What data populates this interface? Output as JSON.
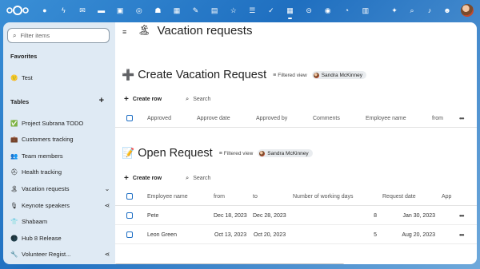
{
  "colors": {
    "accent": "#1d6ec4",
    "sidebar_bg": "#dfeaf4",
    "header_bg": "#2a7fd0"
  },
  "topbar": {
    "app_icons": [
      "dashboard-icon",
      "activity-icon",
      "mail-icon",
      "files-icon",
      "photos-icon",
      "talk-icon",
      "contacts-icon",
      "calendar-icon",
      "notes-icon",
      "deck-icon",
      "favorites-icon",
      "tasks-list-icon",
      "checkmark-icon",
      "tables-icon",
      "circles-icon",
      "maps-icon",
      "help-icon",
      "forms-icon"
    ],
    "active_app": "tables-icon",
    "right_icons": [
      "assistant-icon",
      "search-icon",
      "notifications-icon",
      "contacts-menu-icon"
    ]
  },
  "sidebar": {
    "filter_placeholder": "Filter items",
    "favorites_title": "Favorites",
    "favorites": [
      {
        "emoji": "🙂",
        "label": "Test"
      }
    ],
    "tables_title": "Tables",
    "tables": [
      {
        "emoji": "✅",
        "label": "Project Subrana TODO",
        "action": ""
      },
      {
        "emoji": "💼",
        "label": "Customers tracking",
        "action": ""
      },
      {
        "emoji": "👥",
        "label": "Team members",
        "action": ""
      },
      {
        "emoji": "⛑",
        "label": "Health tracking",
        "action": ""
      },
      {
        "emoji": "🏝",
        "label": "Vacation requests",
        "action": "⌄"
      },
      {
        "emoji": "🎙",
        "label": "Keynote speakers",
        "action": "share"
      },
      {
        "emoji": "👕",
        "label": "Shabaam",
        "action": ""
      },
      {
        "emoji": "🌑",
        "label": "Hub 8 Release",
        "action": ""
      },
      {
        "emoji": "🔧",
        "label": "Volunteer Regist...",
        "action": "share"
      }
    ]
  },
  "main": {
    "title_emoji": "🏝",
    "title": "Vacation requests",
    "views": [
      {
        "emoji": "➕",
        "title": "Create Vacation Request",
        "filter_label": "Filtered view",
        "user": "Sandra McKinney",
        "create_label": "Create row",
        "search_placeholder": "Search",
        "columns": [
          "Approved",
          "Approve date",
          "Approved by",
          "Comments",
          "Employee name",
          "from"
        ],
        "rows": []
      },
      {
        "emoji": "📝",
        "title": "Open Request",
        "filter_label": "Filtered view",
        "user": "Sandra McKinney",
        "create_label": "Create row",
        "search_placeholder": "Search",
        "columns": [
          "Employee name",
          "from",
          "to",
          "Number of working days",
          "Request date",
          "App"
        ],
        "rows": [
          [
            "Pete",
            "Dec 18, 2023",
            "Dec 28, 2023",
            "8",
            "Jan 30, 2023"
          ],
          [
            "Leon Green",
            "Oct 13, 2023",
            "Oct 20, 2023",
            "5",
            "Aug 20, 2023"
          ]
        ]
      }
    ]
  }
}
